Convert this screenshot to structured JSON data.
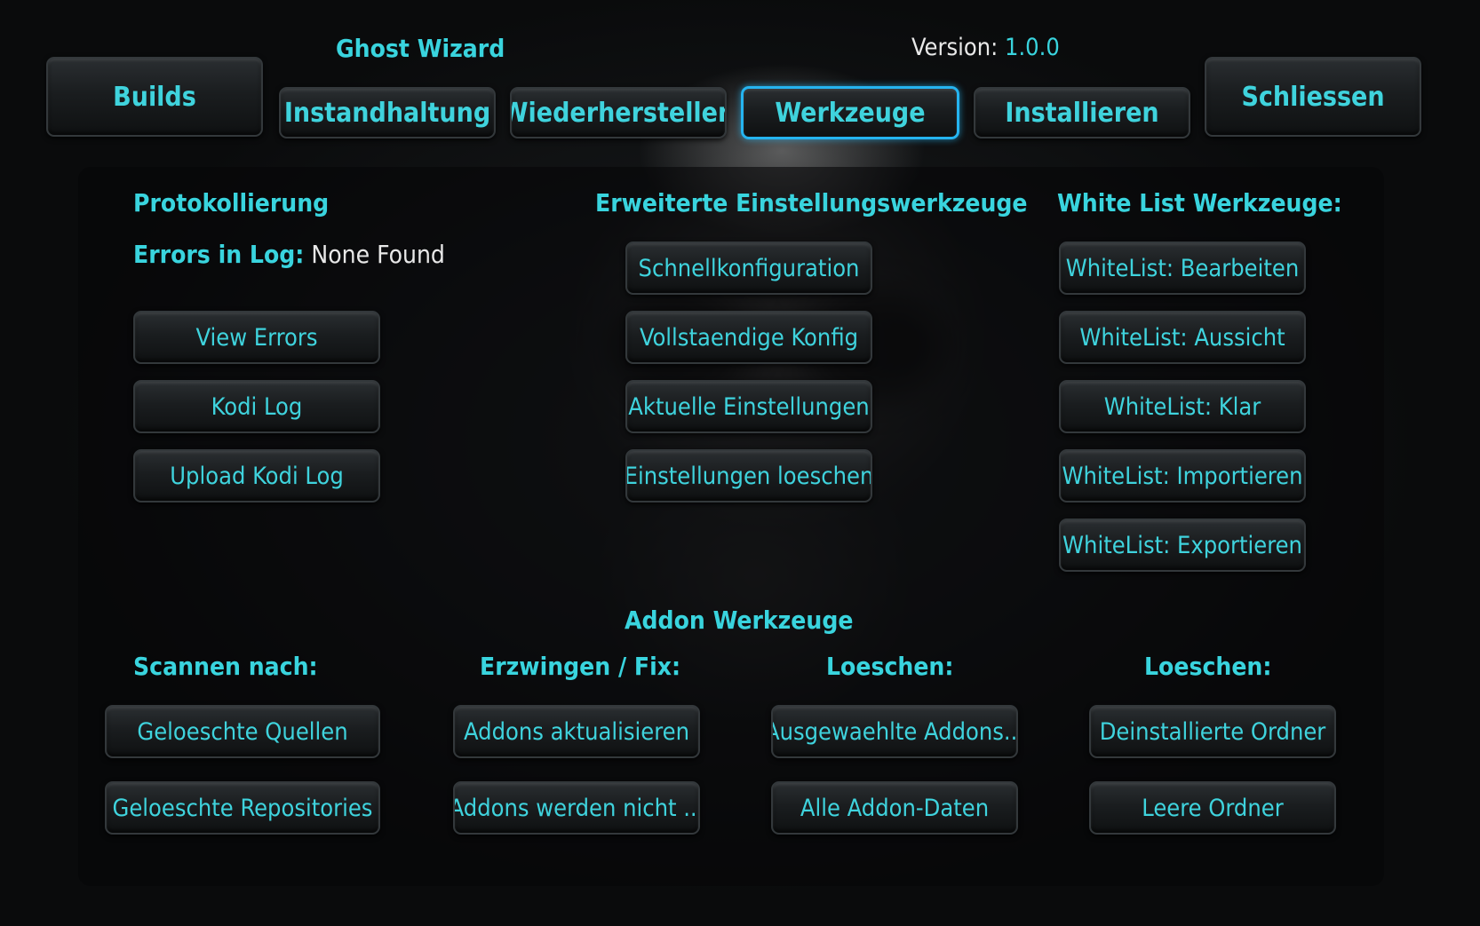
{
  "app": {
    "title": "Ghost Wizard",
    "version_label": "Version:",
    "version": "1.0.0"
  },
  "tabs": [
    {
      "label": "Builds"
    },
    {
      "label": "Instandhaltung"
    },
    {
      "label": "Wiederherstellen"
    },
    {
      "label": "Werkzeuge",
      "active": true
    },
    {
      "label": "Installieren"
    },
    {
      "label": "Schliessen"
    }
  ],
  "logging": {
    "heading": "Protokollierung",
    "errors_label": "Errors in Log:",
    "errors_value": "None Found",
    "buttons": [
      "View Errors",
      "Kodi Log",
      "Upload Kodi Log"
    ]
  },
  "advanced": {
    "heading": "Erweiterte Einstellungswerkzeuge",
    "buttons": [
      "Schnellkonfiguration",
      "Vollstaendige Konfig",
      "Aktuelle Einstellungen",
      "Einstellungen loeschen"
    ]
  },
  "whitelist": {
    "heading": "White List Werkzeuge:",
    "buttons": [
      "WhiteList: Bearbeiten",
      "WhiteList: Aussicht",
      "WhiteList: Klar",
      "WhiteList: Importieren",
      "WhiteList: Exportieren"
    ]
  },
  "addon": {
    "heading": "Addon Werkzeuge",
    "groups": [
      {
        "heading": "Scannen nach:",
        "buttons": [
          "Geloeschte Quellen",
          "Geloeschte Repositories"
        ]
      },
      {
        "heading": "Erzwingen / Fix:",
        "buttons": [
          "Addons aktualisieren",
          "Addons werden nicht ..."
        ]
      },
      {
        "heading": "Loeschen:",
        "buttons": [
          "Ausgewaehlte Addons...",
          "Alle Addon-Daten"
        ]
      },
      {
        "heading": "Loeschen:",
        "buttons": [
          "Deinstallierte Ordner",
          "Leere Ordner"
        ]
      }
    ]
  },
  "colors": {
    "accent": "#39d4de",
    "active_border": "#25b4f0",
    "background": "#0b0c0d"
  }
}
